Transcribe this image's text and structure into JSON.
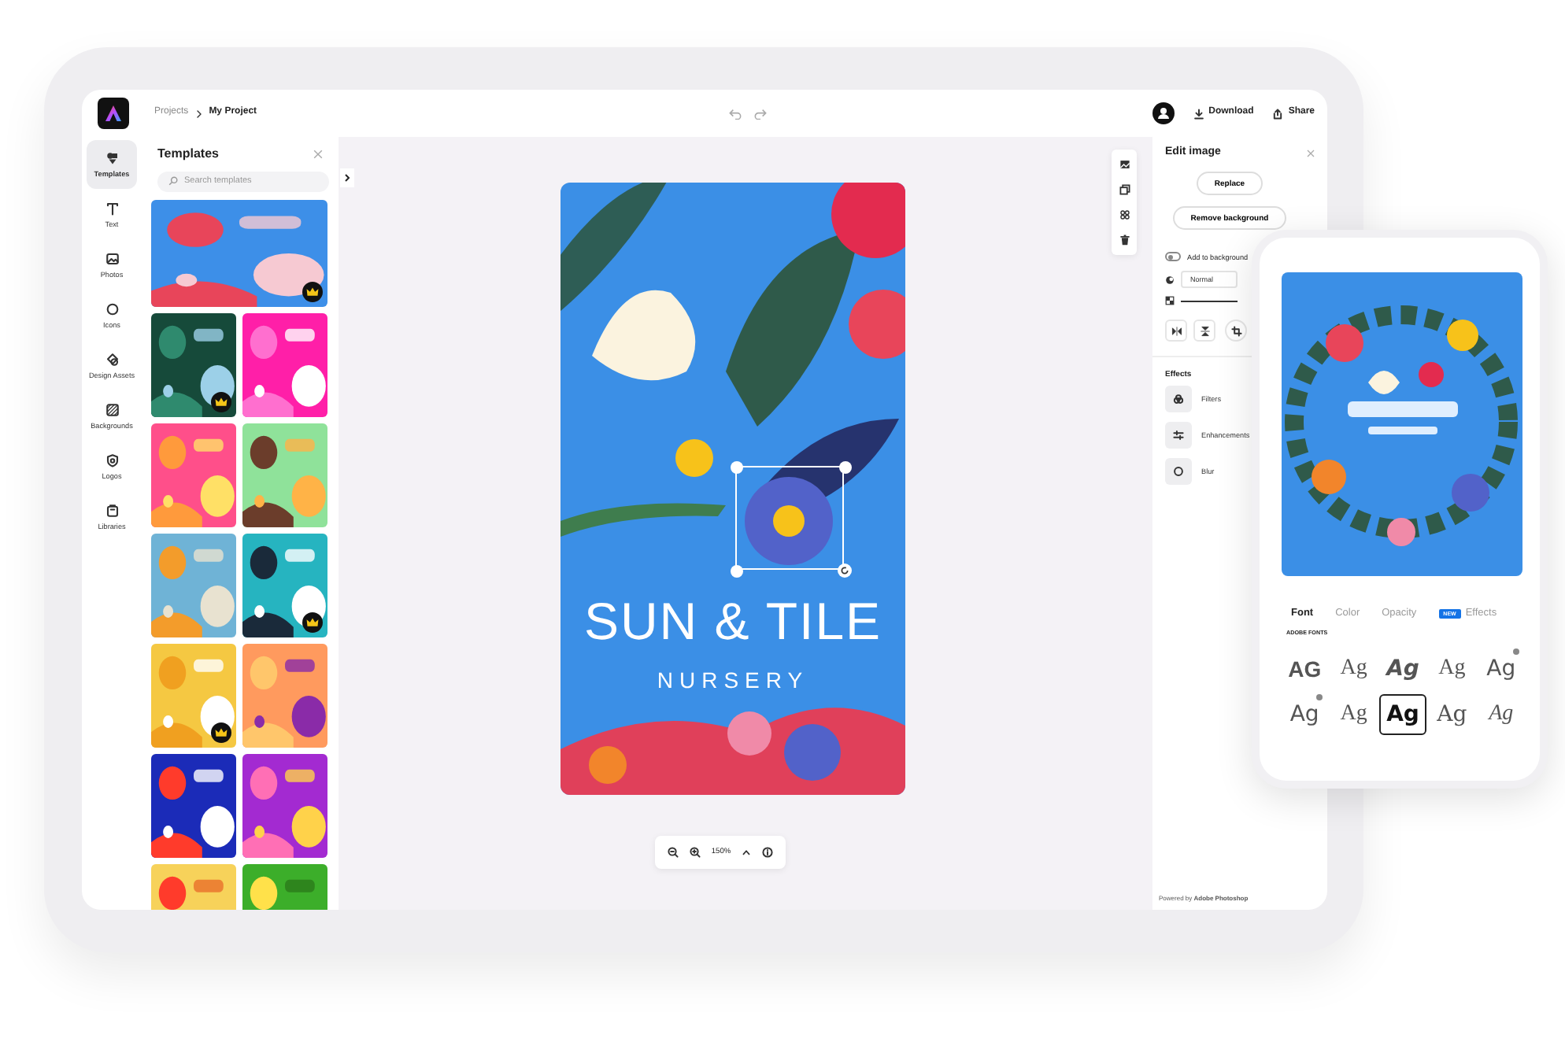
{
  "topbar": {
    "breadcrumb": [
      {
        "label": "Projects",
        "current": false
      },
      {
        "label": "My Project",
        "current": true
      }
    ],
    "actions": [
      {
        "kind": "download",
        "label": "Download"
      },
      {
        "kind": "share",
        "label": "Share"
      }
    ]
  },
  "rail": [
    {
      "kind": "templates",
      "label": "Templates",
      "selected": true
    },
    {
      "kind": "text",
      "label": "Text",
      "selected": false
    },
    {
      "kind": "photos",
      "label": "Photos",
      "selected": false
    },
    {
      "kind": "icons",
      "label": "Icons",
      "selected": false
    },
    {
      "kind": "assets",
      "label": "Design Assets",
      "selected": false
    },
    {
      "kind": "backgrounds",
      "label": "Backgrounds",
      "selected": false
    },
    {
      "kind": "logos",
      "label": "Logos",
      "selected": false
    },
    {
      "kind": "libraries",
      "label": "Libraries",
      "selected": false
    }
  ],
  "templates_panel": {
    "title": "Templates",
    "search": {
      "placeholder": "Search templates"
    },
    "thumbnails": [
      {
        "kind": "picture",
        "wide": true,
        "premium": true
      },
      {
        "kind": "picture",
        "wide": false,
        "premium": true
      },
      {
        "kind": "picture",
        "wide": false,
        "premium": false
      },
      {
        "kind": "picture",
        "wide": false,
        "premium": false
      },
      {
        "kind": "picture",
        "wide": false,
        "premium": false
      },
      {
        "kind": "picture",
        "wide": false,
        "premium": false
      },
      {
        "kind": "picture",
        "wide": false,
        "premium": true
      },
      {
        "kind": "picture",
        "wide": false,
        "premium": true
      },
      {
        "kind": "picture",
        "wide": false,
        "premium": false
      },
      {
        "kind": "picture",
        "wide": false,
        "premium": false
      },
      {
        "kind": "picture",
        "wide": false,
        "premium": false
      },
      {
        "kind": "picture",
        "wide": false
      },
      {
        "kind": "picture",
        "wide": false
      }
    ]
  },
  "canvas": {
    "design": {
      "title": "SUN & TILE",
      "subtitle": "NURSERY"
    },
    "zoom": "150%"
  },
  "edit_panel": {
    "title": "Edit image",
    "buttons": [
      "Replace",
      "Remove background"
    ],
    "add_to_background": {
      "label": "Add to background",
      "on": false
    },
    "blend": "Normal",
    "opacity": {
      "level": 1
    },
    "effects_title": "Effects",
    "effects": [
      {
        "kind": "filters",
        "label": "Filters"
      },
      {
        "kind": "enhancements",
        "label": "Enhancements"
      },
      {
        "kind": "blur",
        "label": "Blur"
      }
    ],
    "footer": "Powered by **Adobe Photoshop**"
  },
  "phone": {
    "tabs": [
      {
        "label": "Font",
        "selected": true
      },
      {
        "label": "Color",
        "selected": false
      },
      {
        "label": "Opacity",
        "selected": false
      },
      {
        "label": "Effects",
        "selected": false,
        "badge": "NEW"
      }
    ],
    "section": "ADOBE FONTS",
    "fonts": [
      {
        "sample": "AG",
        "selected": false,
        "dot": false
      },
      {
        "sample": "Ag",
        "selected": false,
        "dot": false
      },
      {
        "sample": "Ag",
        "selected": false,
        "dot": false
      },
      {
        "sample": "Ag",
        "selected": false,
        "dot": false
      },
      {
        "sample": "Ag",
        "selected": false,
        "dot": true
      },
      {
        "sample": "Ag",
        "selected": false,
        "dot": true
      },
      {
        "sample": "Ag",
        "selected": false,
        "dot": false
      },
      {
        "sample": "Ag",
        "selected": true,
        "dot": false
      },
      {
        "sample": "Ag",
        "selected": false,
        "dot": false
      },
      {
        "sample": "Ag",
        "selected": false,
        "dot": false
      }
    ]
  }
}
